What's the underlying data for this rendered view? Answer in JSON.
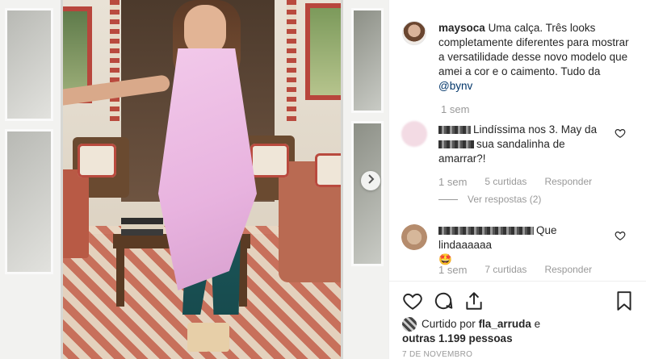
{
  "caption": {
    "username": "maysoca",
    "text": "Uma calça. Três looks completamente diferentes para mostrar a versatilidade desse novo modelo que amei a cor e o caimento. Tudo da ",
    "mention": "@bynv",
    "time": "1 sem"
  },
  "comments": [
    {
      "text_a": "Lindíssima nos 3. May da",
      "text_b": "sua sandalinha de amarrar?!",
      "time": "1 sem",
      "likes": "5 curtidas",
      "reply": "Responder",
      "view_replies": "Ver respostas (2)"
    },
    {
      "text_tail": "Que lindaaaaaa",
      "emoji": "🤩",
      "time": "1 sem",
      "likes": "7 curtidas",
      "reply": "Responder"
    }
  ],
  "liked_by": {
    "prefix": "Curtido por",
    "user": "fla_arruda",
    "connector": "e",
    "others": "outras 1.199 pessoas"
  },
  "date": "7 DE NOVEMBRO",
  "icons": {
    "like": "heart-icon",
    "comment": "comment-icon",
    "share": "share-icon",
    "save": "bookmark-icon",
    "next": "chevron-right-icon"
  },
  "colors": {
    "text": "#262626",
    "muted": "#999999",
    "link": "#003569"
  }
}
